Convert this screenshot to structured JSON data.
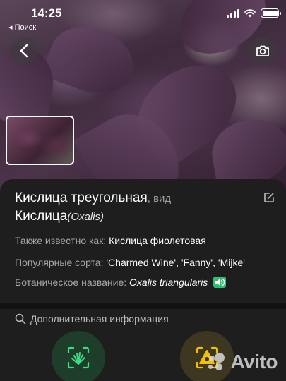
{
  "status_bar": {
    "time": "14:25",
    "back_app_label": "◂ Поиск"
  },
  "photo": {
    "back_icon": "chevron-left-icon",
    "camera_icon": "camera-icon"
  },
  "plant": {
    "name": "Кислица треугольная",
    "rank_suffix": ", вид",
    "genus": "Кислица",
    "genus_latin": "(Oxalis)",
    "also_known_label": "Также известно как:",
    "also_known_value": "Кислица фиолетовая",
    "popular_label": "Популярные сорта:",
    "popular_value": "'Charmed Wine', 'Fanny', 'Mijke'",
    "botanical_label": "Ботаническое название:",
    "botanical_value": "Oxalis triangularis"
  },
  "sheet": {
    "more_info_label": "Дополнительная информация"
  },
  "watermark": {
    "text": "Avito"
  },
  "colors": {
    "sheet_bg": "#1e1e1e",
    "accent_green": "#2fbf71",
    "accent_yellow": "#f2c200"
  }
}
